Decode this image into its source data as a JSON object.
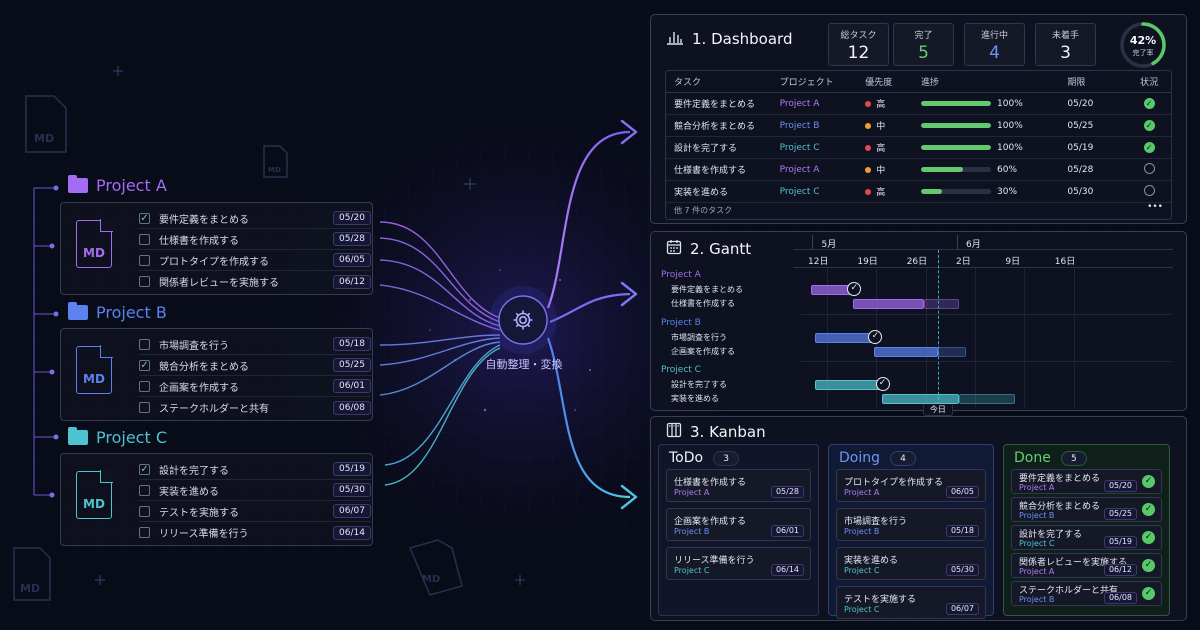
{
  "left": {
    "md_label": "MD",
    "projects": [
      {
        "name": "Project A",
        "color": "#a46cf2",
        "tasks": [
          {
            "name": "要件定義をまとめる",
            "date": "05/20",
            "done": true
          },
          {
            "name": "仕様書を作成する",
            "date": "05/28",
            "done": false
          },
          {
            "name": "プロトタイプを作成する",
            "date": "06/05",
            "done": false
          },
          {
            "name": "関係者レビューを実施する",
            "date": "06/12",
            "done": false
          }
        ]
      },
      {
        "name": "Project B",
        "color": "#5b82f0",
        "tasks": [
          {
            "name": "市場調査を行う",
            "date": "05/18",
            "done": false
          },
          {
            "name": "競合分析をまとめる",
            "date": "05/25",
            "done": true
          },
          {
            "name": "企画案を作成する",
            "date": "06/01",
            "done": false
          },
          {
            "name": "ステークホルダーと共有",
            "date": "06/08",
            "done": false
          }
        ]
      },
      {
        "name": "Project C",
        "color": "#4fc3cf",
        "tasks": [
          {
            "name": "設計を完了する",
            "date": "05/19",
            "done": true
          },
          {
            "name": "実装を進める",
            "date": "05/30",
            "done": false
          },
          {
            "name": "テストを実施する",
            "date": "06/07",
            "done": false
          },
          {
            "name": "リリース準備を行う",
            "date": "06/14",
            "done": false
          }
        ]
      }
    ]
  },
  "hub": {
    "label": "自動整理・変換"
  },
  "dashboard": {
    "title": "1. Dashboard",
    "stats": [
      {
        "label": "総タスク",
        "value": "12",
        "color": "#f2f3f9"
      },
      {
        "label": "完了",
        "value": "5",
        "color": "#63d072"
      },
      {
        "label": "進行中",
        "value": "4",
        "color": "#6b95f5"
      },
      {
        "label": "未着手",
        "value": "3",
        "color": "#f2f3f9"
      }
    ],
    "completion": {
      "value": "42%",
      "label": "完了率",
      "fraction": 0.42
    },
    "columns": [
      "タスク",
      "プロジェクト",
      "優先度",
      "進捗",
      "期限",
      "状況"
    ],
    "rows": [
      {
        "task": "要件定義をまとめる",
        "project": "Project A",
        "pcolor": "#b07cf5",
        "priority": "高",
        "dot": "#e5484d",
        "progress": "100%",
        "fraction": 1.0,
        "due": "05/20",
        "done": true
      },
      {
        "task": "競合分析をまとめる",
        "project": "Project B",
        "pcolor": "#6b8ff5",
        "priority": "中",
        "dot": "#f0a030",
        "progress": "100%",
        "fraction": 1.0,
        "due": "05/25",
        "done": true
      },
      {
        "task": "設計を完了する",
        "project": "Project C",
        "pcolor": "#4fc3cf",
        "priority": "高",
        "dot": "#e5484d",
        "progress": "100%",
        "fraction": 1.0,
        "due": "05/19",
        "done": true
      },
      {
        "task": "仕様書を作成する",
        "project": "Project A",
        "pcolor": "#b07cf5",
        "priority": "中",
        "dot": "#f0a030",
        "progress": "60%",
        "fraction": 0.6,
        "due": "05/28",
        "done": false
      },
      {
        "task": "実装を進める",
        "project": "Project C",
        "pcolor": "#4fc3cf",
        "priority": "高",
        "dot": "#e5484d",
        "progress": "30%",
        "fraction": 0.3,
        "due": "05/30",
        "done": false
      }
    ],
    "more": "他 7 件のタスク",
    "more_icon": "•••"
  },
  "gantt": {
    "title": "2. Gantt",
    "months": [
      "5月",
      "6月"
    ],
    "days": [
      "12日",
      "19日",
      "26日",
      "2日",
      "9日",
      "16日"
    ],
    "today": "今日",
    "groups": [
      {
        "project": "Project A",
        "color": "#a46cf2",
        "tasks": [
          {
            "name": "要件定義をまとめる",
            "start": 12,
            "end": 18,
            "done": true
          },
          {
            "name": "仕様書を作成する",
            "start": 18,
            "end": 28,
            "extend": 33
          }
        ]
      },
      {
        "project": "Project B",
        "color": "#5b82f0",
        "tasks": [
          {
            "name": "市場調査を行う",
            "start": 12.5,
            "end": 21,
            "done": true
          },
          {
            "name": "企画案を作成する",
            "start": 21,
            "end": 30,
            "extend": 34
          }
        ]
      },
      {
        "project": "Project C",
        "color": "#4fc3cf",
        "tasks": [
          {
            "name": "設計を完了する",
            "start": 12.5,
            "end": 22,
            "done": true
          },
          {
            "name": "実装を進める",
            "start": 22,
            "end": 33,
            "extend": 41
          }
        ]
      }
    ]
  },
  "kanban": {
    "title": "3. Kanban",
    "columns": [
      {
        "name": "ToDo",
        "count": "3",
        "color": "#f2f3f9",
        "cards": [
          {
            "task": "仕様書を作成する",
            "project": "Project A",
            "pcolor": "#b07cf5",
            "date": "05/28"
          },
          {
            "task": "企画案を作成する",
            "project": "Project B",
            "pcolor": "#6b8ff5",
            "date": "06/01"
          },
          {
            "task": "リリース準備を行う",
            "project": "Project C",
            "pcolor": "#4fc3cf",
            "date": "06/14"
          }
        ]
      },
      {
        "name": "Doing",
        "count": "4",
        "color": "#6b95f5",
        "cards": [
          {
            "task": "プロトタイプを作成する",
            "project": "Project A",
            "pcolor": "#b07cf5",
            "date": "06/05"
          },
          {
            "task": "市場調査を行う",
            "project": "Project B",
            "pcolor": "#6b8ff5",
            "date": "05/18"
          },
          {
            "task": "実装を進める",
            "project": "Project C",
            "pcolor": "#4fc3cf",
            "date": "05/30"
          },
          {
            "task": "テストを実施する",
            "project": "Project C",
            "pcolor": "#4fc3cf",
            "date": "06/07"
          }
        ]
      },
      {
        "name": "Done",
        "count": "5",
        "color": "#63d072",
        "cards": [
          {
            "task": "要件定義をまとめる",
            "project": "Project A",
            "pcolor": "#b07cf5",
            "date": "05/20"
          },
          {
            "task": "競合分析をまとめる",
            "project": "Project B",
            "pcolor": "#6b8ff5",
            "date": "05/25"
          },
          {
            "task": "設計を完了する",
            "project": "Project C",
            "pcolor": "#4fc3cf",
            "date": "05/19"
          },
          {
            "task": "関係者レビューを実施する",
            "project": "Project A",
            "pcolor": "#b07cf5",
            "date": "06/12"
          },
          {
            "task": "ステークホルダーと共有",
            "project": "Project B",
            "pcolor": "#6b8ff5",
            "date": "06/08"
          }
        ]
      }
    ]
  }
}
